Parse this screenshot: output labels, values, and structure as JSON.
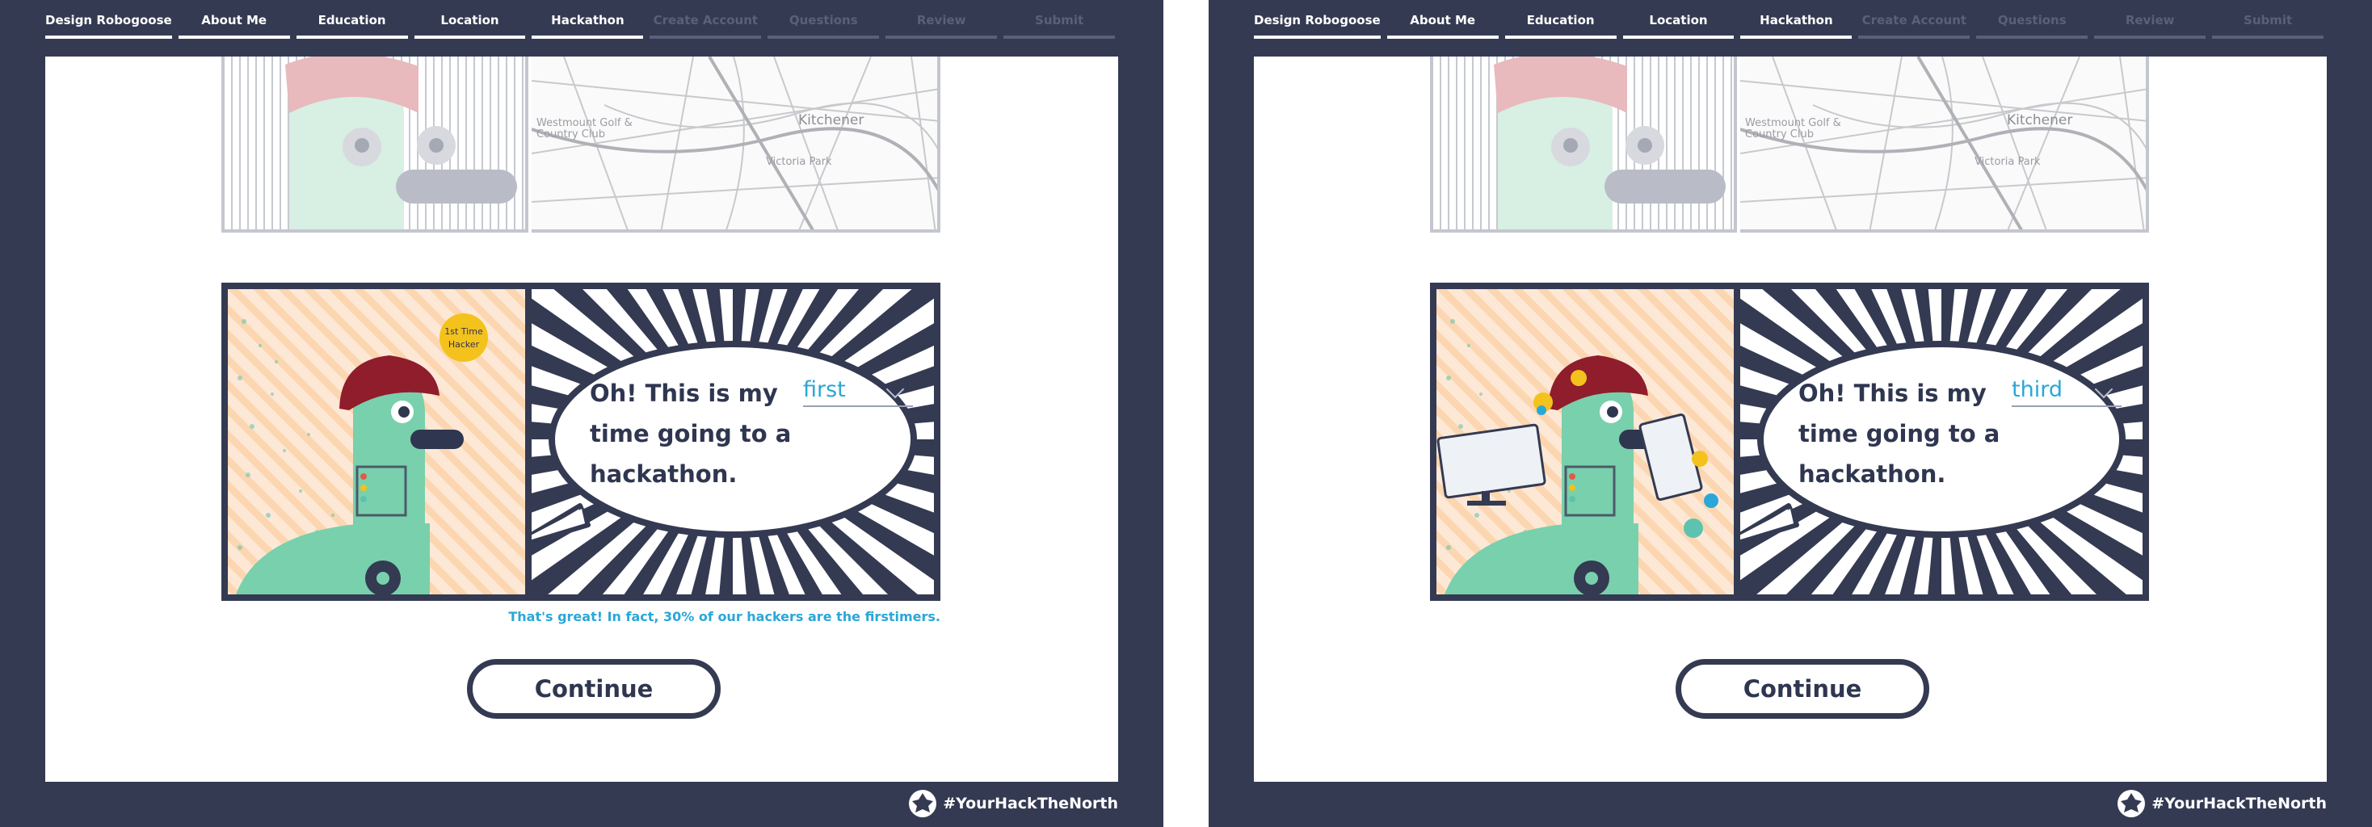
{
  "nav": {
    "items": [
      {
        "label": "Design Robogoose",
        "active": true
      },
      {
        "label": "About Me",
        "active": true
      },
      {
        "label": "Education",
        "active": true
      },
      {
        "label": "Location",
        "active": true
      },
      {
        "label": "Hackathon",
        "active": true
      },
      {
        "label": "Create Account",
        "active": false
      },
      {
        "label": "Questions",
        "active": false
      },
      {
        "label": "Review",
        "active": false
      },
      {
        "label": "Submit",
        "active": false
      }
    ]
  },
  "map": {
    "labels": [
      "Westmount Golf & Country Club",
      "Kitchener",
      "Victoria Park"
    ]
  },
  "left": {
    "bubble": {
      "prefix": "Oh! This is my",
      "line2": "time going to a",
      "line3": "hackathon."
    },
    "dropdown_value": "first",
    "badge": "1st Time Hacker",
    "note": "That's great! In fact, 30% of our hackers are the firstimers.",
    "continue_label": "Continue"
  },
  "right": {
    "bubble": {
      "prefix": "Oh! This is my",
      "line2": "time going to a",
      "line3": "hackathon."
    },
    "dropdown_value": "third",
    "continue_label": "Continue"
  },
  "footer": {
    "hashtag": "#YourHackTheNorth"
  },
  "colors": {
    "navy": "#343a52",
    "accent": "#2aa7d8",
    "goose_green": "#79d0ac",
    "beret": "#8f1d2c",
    "badge_yellow": "#f4c21c"
  }
}
